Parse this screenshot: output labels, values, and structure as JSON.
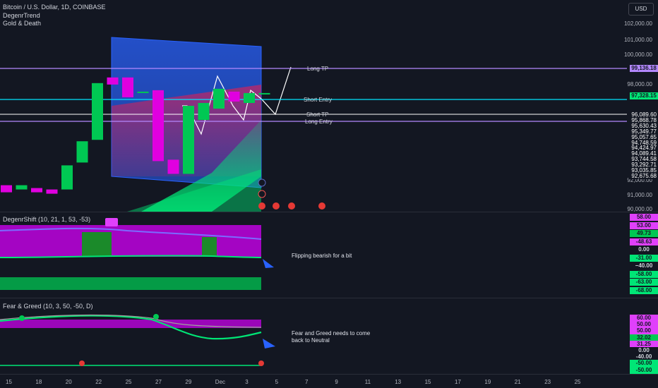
{
  "header": {
    "symbol": "Bitcoin / U.S. Dollar, 1D, COINBASE",
    "indicator1": "DegenrTrend",
    "indicator2": "Gold & Death",
    "currency_button": "USD"
  },
  "price_axis": {
    "ticks": [
      "102,000.00",
      "101,000.00",
      "100,000.00",
      "98,000.00",
      "92,000.00",
      "91,000.00",
      "90,000.00"
    ],
    "long_tp_tag": "99,136.18",
    "short_entry_tag": "97,328.15",
    "stack": [
      "96,089.60",
      "95,868.78",
      "95,630.43",
      "95,349.77",
      "95,057.65",
      "94,748.59",
      "94,424.97",
      "94,089.41",
      "93,744.58",
      "93,292.71",
      "93,035.85",
      "92,675.68"
    ]
  },
  "lines": {
    "long_tp": "Long TP",
    "short_entry": "Short Entry",
    "short_tp": "Short TP",
    "long_entry": "Long Entry"
  },
  "candles": [
    {
      "dir": "down",
      "o": 90.9,
      "c": 90.4
    },
    {
      "dir": "up",
      "o": 90.6,
      "c": 90.9
    },
    {
      "dir": "down",
      "o": 90.7,
      "c": 90.4
    },
    {
      "dir": "down",
      "o": 90.6,
      "c": 90.3
    },
    {
      "dir": "up",
      "o": 90.6,
      "c": 92.3
    },
    {
      "dir": "up",
      "o": 92.5,
      "c": 94.0
    },
    {
      "dir": "up",
      "o": 94.1,
      "c": 98.1
    },
    {
      "dir": "down",
      "o": 98.5,
      "c": 98.0
    },
    {
      "dir": "down",
      "o": 98.5,
      "c": 97.1
    },
    {
      "dir": "up",
      "o": 97.5,
      "c": 97.5
    },
    {
      "dir": "down",
      "o": 97.6,
      "c": 92.6
    },
    {
      "dir": "down",
      "o": 92.7,
      "c": 91.7
    },
    {
      "dir": "up",
      "o": 91.7,
      "c": 96.5
    },
    {
      "dir": "up",
      "o": 95.5,
      "c": 96.7
    },
    {
      "dir": "up",
      "o": 96.3,
      "c": 97.7
    },
    {
      "dir": "down",
      "o": 97.5,
      "c": 96.8
    },
    {
      "dir": "up",
      "o": 96.7,
      "c": 97.4
    },
    {
      "dir": "up",
      "o": 97.3,
      "c": 97.4
    }
  ],
  "degen_shift": {
    "title": "DegenrShift (10, 21, 1, 53, -53)",
    "tags": [
      {
        "text": "58.00",
        "color": "#e040fb"
      },
      {
        "text": "53.00",
        "color": "#e040fb"
      },
      {
        "text": "49.73",
        "color": "#00c853"
      },
      {
        "text": "-48.63",
        "color": "#e040fb"
      },
      {
        "text": "0.00",
        "color": "#131722"
      },
      {
        "text": "-31.00",
        "color": "#00e676"
      },
      {
        "text": "−40.00",
        "color": "#131722"
      },
      {
        "text": "-58.00",
        "color": "#00e676"
      },
      {
        "text": "-63.00",
        "color": "#00e676"
      },
      {
        "text": "-68.00",
        "color": "#00e676"
      }
    ],
    "note": "Flipping bearish for a bit"
  },
  "fear_greed": {
    "title": "Fear & Greed (10, 3, 50, -50, D)",
    "tags": [
      {
        "text": "60.00",
        "color": "#e040fb"
      },
      {
        "text": "50.00",
        "color": "#e040fb"
      },
      {
        "text": "50.00",
        "color": "#e040fb"
      },
      {
        "text": "32.02",
        "color": "#00c853"
      },
      {
        "text": "31.25",
        "color": "#e040fb"
      },
      {
        "text": "0.00",
        "color": "#131722"
      },
      {
        "text": "-40.00",
        "color": "#131722"
      },
      {
        "text": "-50.00",
        "color": "#00e676"
      },
      {
        "text": "-50.00",
        "color": "#00e676"
      }
    ],
    "note_line1": "Fear and Greed needs to come",
    "note_line2": "back to Neutral"
  },
  "x_axis": [
    "15",
    "18",
    "20",
    "22",
    "25",
    "27",
    "29",
    "Dec",
    "3",
    "5",
    "7",
    "9",
    "11",
    "13",
    "15",
    "17",
    "19",
    "21",
    "23",
    "25"
  ]
}
